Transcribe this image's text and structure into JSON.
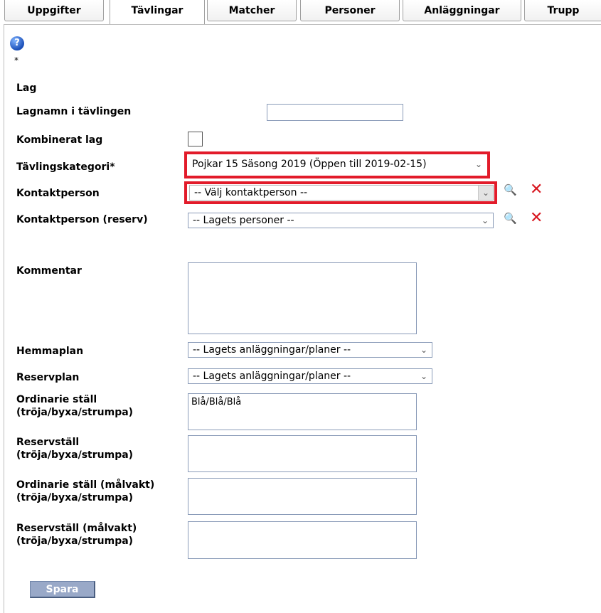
{
  "tabs": [
    {
      "label": "Uppgifter"
    },
    {
      "label": "Tävlingar"
    },
    {
      "label": "Matcher"
    },
    {
      "label": "Personer"
    },
    {
      "label": "Anläggningar"
    },
    {
      "label": "Trupp"
    }
  ],
  "help_icon": "?",
  "required_marker": "*",
  "form": {
    "section_label": "Lag",
    "team_name": {
      "label": "Lagnamn i tävlingen",
      "value": ""
    },
    "combined_team": {
      "label": "Kombinerat lag",
      "checked": false
    },
    "competition_category": {
      "label": "Tävlingskategori*",
      "selected": "Pojkar 15 Säsong 2019 (Öppen till 2019-02-15)"
    },
    "contact_person": {
      "label": "Kontaktperson",
      "selected": "-- Välj kontaktperson --"
    },
    "contact_person_reserve": {
      "label": "Kontaktperson (reserv)",
      "selected": "-- Lagets personer --"
    },
    "comment": {
      "label": "Kommentar",
      "value": ""
    },
    "home_ground": {
      "label": "Hemmaplan",
      "selected": "-- Lagets anläggningar/planer --"
    },
    "reserve_ground": {
      "label": "Reservplan",
      "selected": "-- Lagets anläggningar/planer --"
    },
    "kit_ordinary": {
      "label_line1": "Ordinarie ställ",
      "label_line2": "(tröja/byxa/strumpa)",
      "value": "Blå/Blå/Blå"
    },
    "kit_reserve": {
      "label_line1": "Reservställ",
      "label_line2": "(tröja/byxa/strumpa)",
      "value": ""
    },
    "kit_gk_ordinary": {
      "label_line1": "Ordinarie ställ (målvakt)",
      "label_line2": "(tröja/byxa/strumpa)",
      "value": ""
    },
    "kit_gk_reserve": {
      "label_line1": "Reservställ (målvakt)",
      "label_line2": "(tröja/byxa/strumpa)",
      "value": ""
    },
    "save_label": "Spara"
  },
  "colors": {
    "highlight": "#e21b2a",
    "button": "#99a9c8"
  }
}
